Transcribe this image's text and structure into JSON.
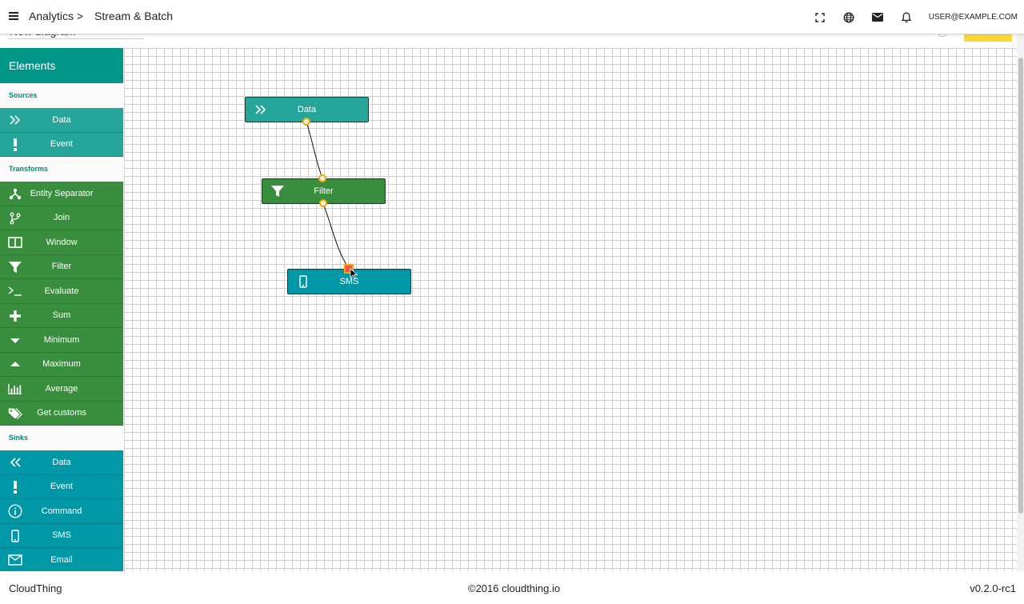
{
  "header": {
    "breadcrumb_root": "Analytics >",
    "breadcrumb_current": "Stream & Batch",
    "user_email": "USER@EXAMPLE.COM",
    "icons": [
      "menu-icon",
      "fullscreen-icon",
      "globe-icon",
      "mail-icon",
      "bell-icon"
    ]
  },
  "diagram": {
    "name": "New diagram"
  },
  "sidebar": {
    "title": "Elements",
    "sections": {
      "sources": {
        "title": "Sources",
        "items": [
          {
            "label": "Data",
            "icon": "double-chevron-right-icon"
          },
          {
            "label": "Event",
            "icon": "exclamation-icon"
          }
        ]
      },
      "transforms": {
        "title": "Transforms",
        "items": [
          {
            "label": "Entity Separator",
            "icon": "fork-icon"
          },
          {
            "label": "Join",
            "icon": "branch-icon"
          },
          {
            "label": "Window",
            "icon": "window-icon"
          },
          {
            "label": "Filter",
            "icon": "filter-icon"
          },
          {
            "label": "Evaluate",
            "icon": "terminal-icon"
          },
          {
            "label": "Sum",
            "icon": "plus-icon"
          },
          {
            "label": "Minimum",
            "icon": "caret-down-icon"
          },
          {
            "label": "Maximum",
            "icon": "caret-up-icon"
          },
          {
            "label": "Average",
            "icon": "bar-chart-icon"
          },
          {
            "label": "Get customs",
            "icon": "tags-icon"
          }
        ]
      },
      "sinks": {
        "title": "Sinks",
        "items": [
          {
            "label": "Data",
            "icon": "double-chevron-left-icon"
          },
          {
            "label": "Event",
            "icon": "exclamation-icon"
          },
          {
            "label": "Command",
            "icon": "info-icon"
          },
          {
            "label": "SMS",
            "icon": "phone-icon"
          },
          {
            "label": "Email",
            "icon": "envelope-icon"
          }
        ]
      }
    }
  },
  "canvas": {
    "nodes": [
      {
        "label": "Data",
        "type": "source",
        "icon": "double-chevron-right-icon"
      },
      {
        "label": "Filter",
        "type": "transform",
        "icon": "filter-icon"
      },
      {
        "label": "SMS",
        "type": "sink",
        "icon": "phone-icon"
      }
    ]
  },
  "colors": {
    "source": "#26a69a",
    "transform": "#388e3c",
    "sink": "#0097a7",
    "header_accent": "#009688",
    "port": "#ffa000",
    "action_button": "#fdd835"
  },
  "footer": {
    "brand": "CloudThing",
    "copyright": "©2016 cloudthing.io",
    "version": "v0.2.0-rc1"
  }
}
